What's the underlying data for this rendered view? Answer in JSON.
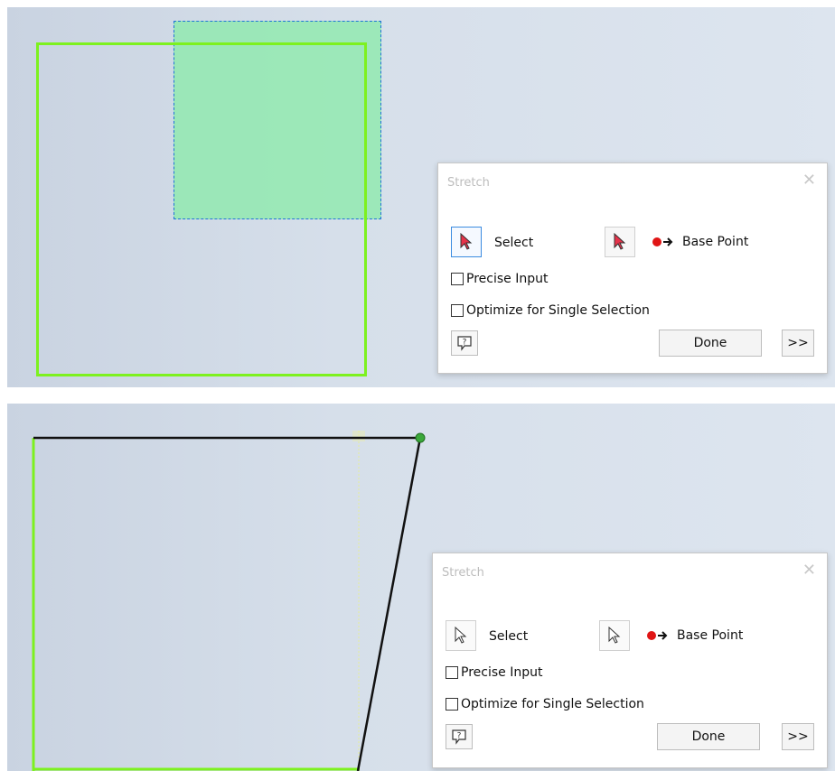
{
  "panels": [
    {
      "dialog": {
        "title": "Stretch",
        "close_glyph": "✕",
        "select_label": "Select",
        "base_point_label": "Base Point",
        "precise_input_label": "Precise Input",
        "precise_input_checked": false,
        "optimize_label": "Optimize for Single Selection",
        "optimize_checked": false,
        "help_icon": "help-icon",
        "done_label": "Done",
        "more_label": ">>",
        "select_state": "active"
      },
      "colors": {
        "sketch_line": "#7df11f",
        "selection_fill": "#8eebaa",
        "selection_border": "#1f74d6"
      }
    },
    {
      "dialog": {
        "title": "Stretch",
        "close_glyph": "✕",
        "select_label": "Select",
        "base_point_label": "Base Point",
        "precise_input_label": "Precise Input",
        "precise_input_checked": false,
        "optimize_label": "Optimize for Single Selection",
        "optimize_checked": false,
        "help_icon": "help-icon",
        "done_label": "Done",
        "more_label": ">>",
        "select_state": "inactive"
      },
      "colors": {
        "sketch_line": "#7df11f",
        "preview_line": "#000000",
        "grip_point": "#3aa83a"
      }
    }
  ]
}
